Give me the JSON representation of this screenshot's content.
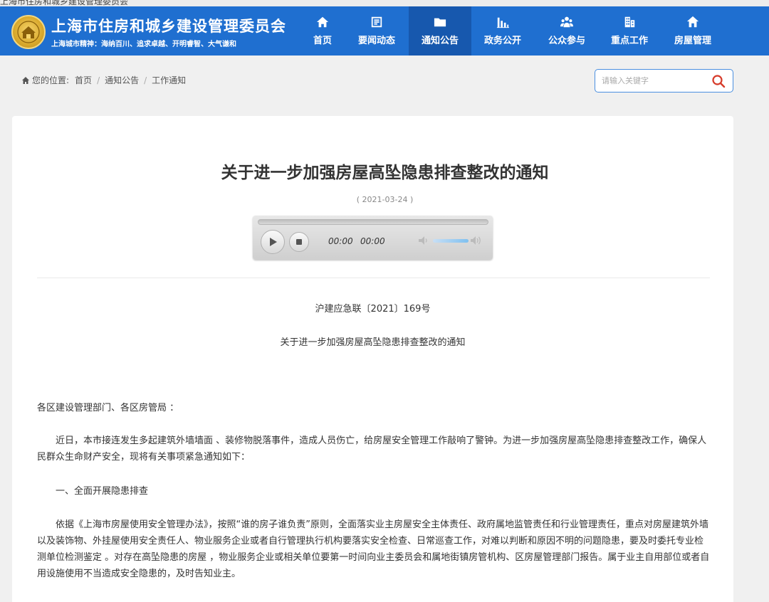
{
  "browser_tab_text": "上海市住房和城乡建设管理委员会",
  "site": {
    "title": "上海市住房和城乡建设管理委员会",
    "subtitle": "上海城市精神：海纳百川、追求卓越、开明睿智、大气谦和",
    "header_color": "#1f6fd0",
    "active_nav_color": "#1758ae"
  },
  "nav": [
    {
      "label": "首页",
      "icon": "home-icon"
    },
    {
      "label": "要闻动态",
      "icon": "news-icon"
    },
    {
      "label": "通知公告",
      "icon": "folder-icon"
    },
    {
      "label": "政务公开",
      "icon": "chart-icon"
    },
    {
      "label": "公众参与",
      "icon": "people-icon"
    },
    {
      "label": "重点工作",
      "icon": "building-icon"
    },
    {
      "label": "房屋管理",
      "icon": "house-icon"
    }
  ],
  "active_nav": "通知公告",
  "breadcrumb": {
    "prefix": "您的位置:",
    "items": [
      "首页",
      "通知公告",
      "工作通知"
    ]
  },
  "search": {
    "placeholder": "请输入关键字",
    "icon": "search-icon"
  },
  "article": {
    "title": "关于进一步加强房屋高坠隐患排查整改的通知",
    "date": "( 2021-03-24 )",
    "doc_number": "沪建应急联〔2021〕169号",
    "doc_title": "关于进一步加强房屋高坠隐患排查整改的通知",
    "salutation": "各区建设管理部门、各区房管局 ：",
    "paragraph1": "近日，本市接连发生多起建筑外墙墙面 、装修物脱落事件，造成人员伤亡，给房屋安全管理工作敲响了警钟。为进一步加强房屋高坠隐患排查整改工作，确保人民群众生命财产安全，现将有关事项紧急通知如下：",
    "section1": "一、全面开展隐患排查",
    "paragraph2": "依据《上海市房屋使用安全管理办法》，按照“谁的房子谁负责”原则，全面落实业主房屋安全主体责任、政府属地监管责任和行业管理责任，重点对房屋建筑外墙以及装饰物、外挂屋使用安全责任人、物业服务企业或者自行管理执行机构要落实安全检查、日常巡查工作，对难以判断和原因不明的问题隐患，要及时委托专业检测单位检测鉴定 。对存在高坠隐患的房屋 ，物业服务企业或相关单位要第一时间向业主委员会和属地街镇房管机构、区房屋管理部门报告。属于业主自用部位或者自用设施使用不当造成安全隐患的，及时告知业主。"
  },
  "audio_player": {
    "current_time": "00:00",
    "duration": "00:00",
    "progress": 0,
    "play_icon": "play-icon",
    "stop_icon": "stop-icon",
    "volume_low_icon": "volume-low-icon",
    "volume_high_icon": "volume-high-icon"
  }
}
